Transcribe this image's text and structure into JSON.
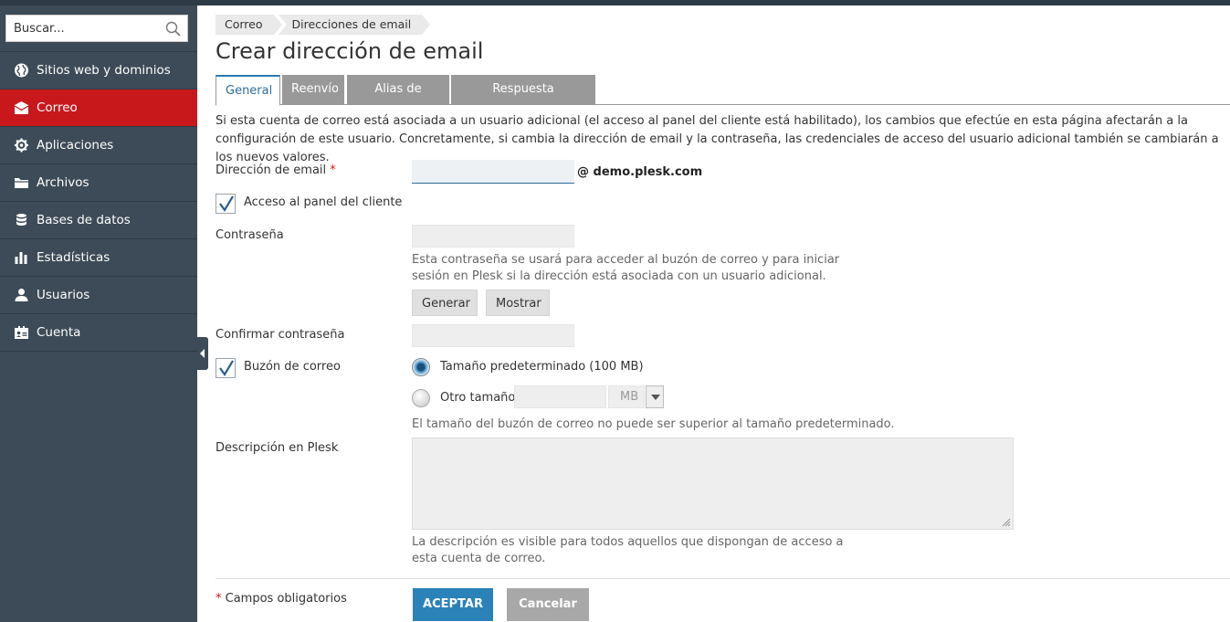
{
  "search": {
    "placeholder": "Buscar..."
  },
  "sidebar": {
    "items": [
      {
        "label": "Sitios web y dominios",
        "icon": "globe-icon"
      },
      {
        "label": "Correo",
        "icon": "envelope-icon",
        "active": true
      },
      {
        "label": "Aplicaciones",
        "icon": "gear-icon"
      },
      {
        "label": "Archivos",
        "icon": "folder-icon"
      },
      {
        "label": "Bases de datos",
        "icon": "database-icon"
      },
      {
        "label": "Estadísticas",
        "icon": "bar-chart-icon"
      },
      {
        "label": "Usuarios",
        "icon": "user-icon"
      },
      {
        "label": "Cuenta",
        "icon": "id-card-icon"
      }
    ],
    "active_color": "#c8181c"
  },
  "breadcrumb": [
    "Correo",
    "Direcciones de email"
  ],
  "page_title": "Crear dirección de email",
  "tabs": [
    {
      "label": "General",
      "active": true
    },
    {
      "label": "Reenvío"
    },
    {
      "label": "Alias de correo"
    },
    {
      "label": "Respuesta automática"
    }
  ],
  "info_text": "Si esta cuenta de correo está asociada a un usuario adicional (el acceso al panel del cliente está habilitado), los cambios que efectúe en esta página afectarán a la configuración de este usuario. Concretamente, si cambia la dirección de email y la contraseña, las credenciales de acceso del usuario adicional también se cambiarán a los nuevos valores.",
  "form": {
    "email_label": "Dirección de email",
    "required_mark": "*",
    "email_value": "",
    "domain": "@ demo.plesk.com",
    "panel_access_label": "Acceso al panel del cliente",
    "panel_access_checked": true,
    "password_label": "Contraseña",
    "password_hint": "Esta contraseña se usará para acceder al buzón de correo y para iniciar sesión en Plesk si la dirección está asociada con un usuario adicional.",
    "generate_label": "Generar",
    "show_label": "Mostrar",
    "confirm_password_label": "Confirmar contraseña",
    "mailbox_label": "Buzón de correo",
    "mailbox_checked": true,
    "default_size_label": "Tamaño predeterminado (100 MB)",
    "other_size_label": "Otro tamaño",
    "size_unit": "MB",
    "size_hint": "El tamaño del buzón de correo no puede ser superior al tamaño predeterminado.",
    "description_label": "Descripción en Plesk",
    "description_hint": "La descripción es visible para todos aquellos que dispongan de acceso a esta cuenta de correo.",
    "required_note": "Campos obligatorios",
    "ok_label": "ACEPTAR",
    "cancel_label": "Cancelar"
  },
  "colors": {
    "primary_button": "#2a82b8",
    "sidebar": "#3c4b57"
  }
}
